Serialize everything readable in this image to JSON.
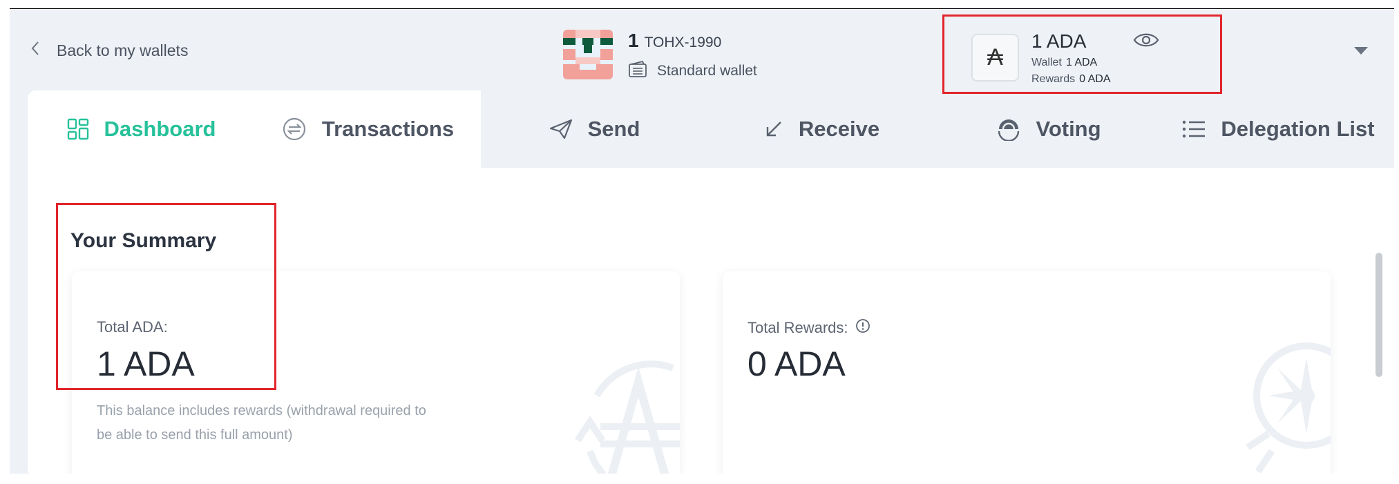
{
  "header": {
    "back_label": "Back to my wallets",
    "wallet_number": "1",
    "wallet_plate": "TOHX-1990",
    "wallet_type": "Standard wallet",
    "balance_main": "1 ADA",
    "wallet_label": "Wallet",
    "wallet_value": "1 ADA",
    "rewards_label": "Rewards",
    "rewards_value": "0 ADA",
    "ada_symbol": "₳"
  },
  "tabs": [
    {
      "label": "Dashboard",
      "icon": "dashboard-icon",
      "active": true
    },
    {
      "label": "Transactions",
      "icon": "transactions-icon",
      "active": false
    },
    {
      "label": "Send",
      "icon": "send-icon",
      "active": false
    },
    {
      "label": "Receive",
      "icon": "receive-icon",
      "active": false
    },
    {
      "label": "Voting",
      "icon": "voting-icon",
      "active": false
    },
    {
      "label": "Delegation List",
      "icon": "list-icon",
      "active": false
    }
  ],
  "summary": {
    "title": "Your Summary",
    "total_ada_label": "Total ADA:",
    "total_ada_value": "1 ADA",
    "total_ada_note": "This balance includes rewards (withdrawal required to be able to send this full amount)",
    "total_rewards_label": "Total Rewards:",
    "total_rewards_value": "0 ADA"
  },
  "colors": {
    "accent": "#27c19a",
    "highlight": "#e1252c",
    "background": "#eef1f5"
  }
}
